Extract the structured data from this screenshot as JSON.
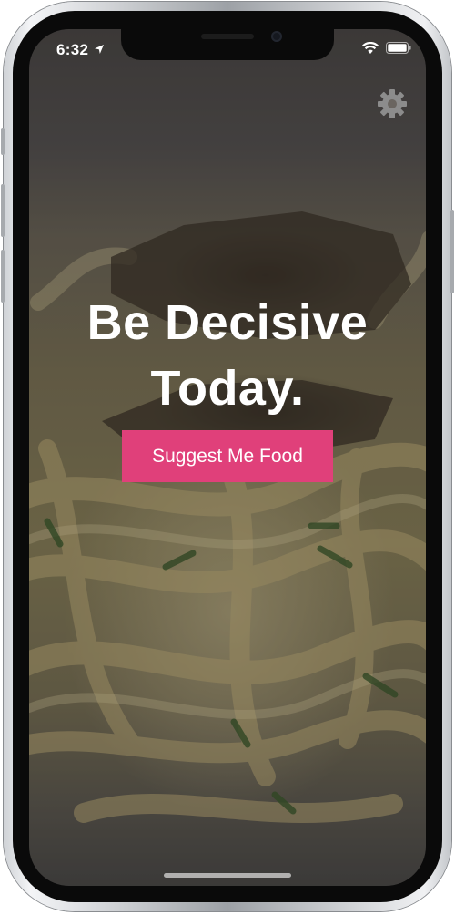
{
  "status_bar": {
    "time": "6:32",
    "icons": [
      "location-arrow-icon",
      "wifi-icon",
      "battery-icon"
    ]
  },
  "header": {
    "settings_icon": "gear-icon"
  },
  "hero": {
    "headline_line1": "Be Decisive",
    "headline_line2": "Today.",
    "cta_label": "Suggest Me Food"
  },
  "colors": {
    "accent": "#e0407a",
    "text": "#ffffff"
  }
}
